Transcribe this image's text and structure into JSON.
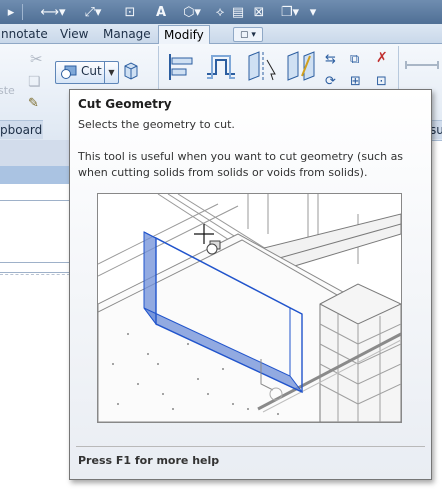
{
  "ribbon_tabs": {
    "annotate": "nnotate",
    "view": "View",
    "manage": "Manage",
    "modify": "Modify",
    "extra": "▢ ▾"
  },
  "ribbon": {
    "cut_label": "Cut",
    "clipboard_label": "pboard",
    "right_panel_label": "su"
  },
  "tooltip": {
    "title": "Cut Geometry",
    "subtitle": "Selects the geometry to cut.",
    "description": "This tool is useful when you want to cut geometry (such as when cutting solids from solids or voids from solids).",
    "footer": "Press F1 for more help"
  },
  "colors": {
    "accent": "#2255cc",
    "ribbon_bg": "#dfe8f3",
    "tooltip_border": "#767676"
  }
}
